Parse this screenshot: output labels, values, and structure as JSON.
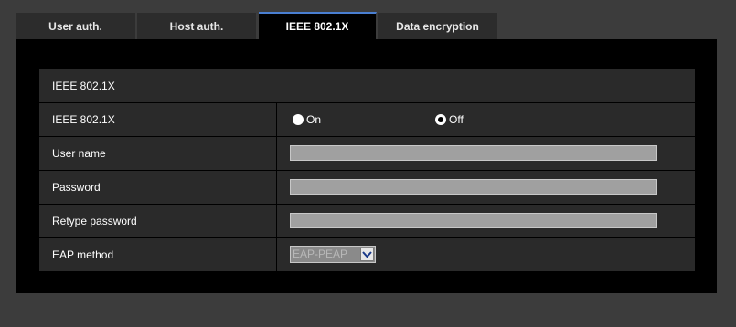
{
  "tabs": [
    {
      "label": "User auth."
    },
    {
      "label": "Host auth."
    },
    {
      "label": "IEEE 802.1X"
    },
    {
      "label": "Data encryption"
    }
  ],
  "section_header": "IEEE 802.1X",
  "rows": {
    "ieee": {
      "label": "IEEE 802.1X",
      "on_label": "On",
      "off_label": "Off",
      "selected": "Off"
    },
    "username": {
      "label": "User name",
      "value": ""
    },
    "password": {
      "label": "Password",
      "value": ""
    },
    "retype": {
      "label": "Retype password",
      "value": ""
    },
    "eap": {
      "label": "EAP method",
      "selected": "EAP-PEAP"
    }
  },
  "colors": {
    "accent": "#4a7fd1",
    "background": "#3c3c3c",
    "panel": "#000000",
    "row": "#2a2a2a"
  },
  "icons": {
    "select_arrow": "chevron-down-icon"
  }
}
